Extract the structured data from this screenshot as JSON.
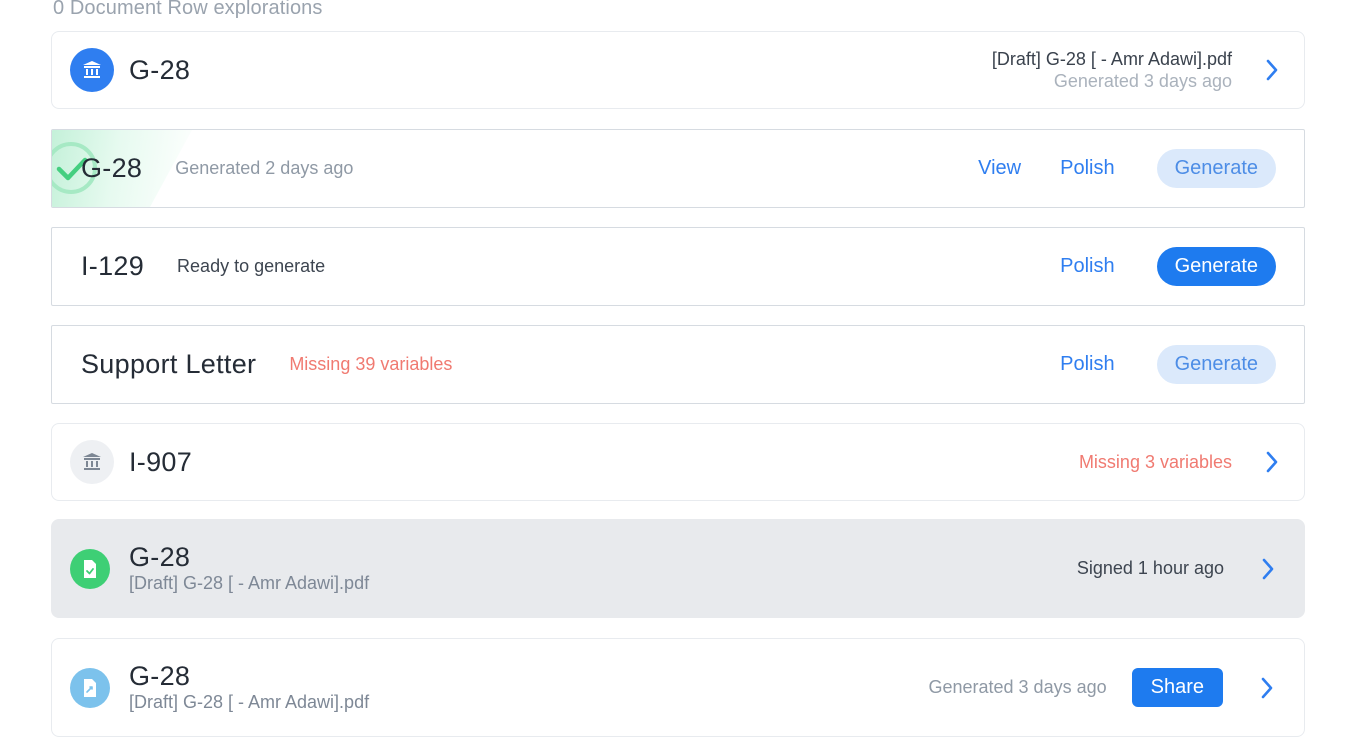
{
  "header": {
    "title": "0 Document Row explorations"
  },
  "rows": [
    {
      "title": "G-28",
      "file": "[Draft] G-28 [ - Amr Adawi].pdf",
      "status": "Generated 3 days ago",
      "icon": "bank-icon"
    },
    {
      "title": "G-28",
      "status": "Generated 2 days ago",
      "actions": {
        "view": "View",
        "polish": "Polish",
        "generate": "Generate"
      },
      "icon": "check-icon"
    },
    {
      "title": "I-129",
      "status": "Ready to generate",
      "actions": {
        "polish": "Polish",
        "generate": "Generate"
      }
    },
    {
      "title": "Support Letter",
      "status": "Missing 39 variables",
      "actions": {
        "polish": "Polish",
        "generate": "Generate"
      }
    },
    {
      "title": "I-907",
      "status": "Missing 3 variables",
      "icon": "bank-icon"
    },
    {
      "title": "G-28",
      "file": "[Draft] G-28 [ - Amr Adawi].pdf",
      "status": "Signed 1 hour ago",
      "icon": "signed-document-icon"
    },
    {
      "title": "G-28",
      "file": "[Draft] G-28 [ - Amr Adawi].pdf",
      "status": "Generated 3 days ago",
      "actions": {
        "share": "Share"
      },
      "icon": "pdf-document-icon"
    }
  ],
  "colors": {
    "primary": "#1e7bef",
    "link": "#2f7ef0",
    "error": "#f07a71",
    "success": "#3ecf75",
    "row_highlight": "#e8eaed"
  }
}
